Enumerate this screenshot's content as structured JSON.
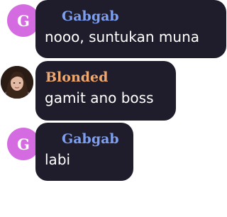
{
  "messages": [
    {
      "sender": "Gabgab",
      "avatar_letter": "G",
      "avatar_color": "#d46be0",
      "name_color": "#7d9ff0",
      "text": "nooo, suntukan muna"
    },
    {
      "sender": "Blonded",
      "avatar_letter": "",
      "avatar_color": "#2a1c15",
      "name_color": "#f0a86e",
      "text": "gamit ano boss"
    },
    {
      "sender": "Gabgab",
      "avatar_letter": "G",
      "avatar_color": "#d46be0",
      "name_color": "#7d9ff0",
      "text": "labi"
    }
  ],
  "colors": {
    "bubble_bg": "#1f1c2b",
    "message_text": "#ffffff",
    "page_bg": "#ffffff"
  }
}
